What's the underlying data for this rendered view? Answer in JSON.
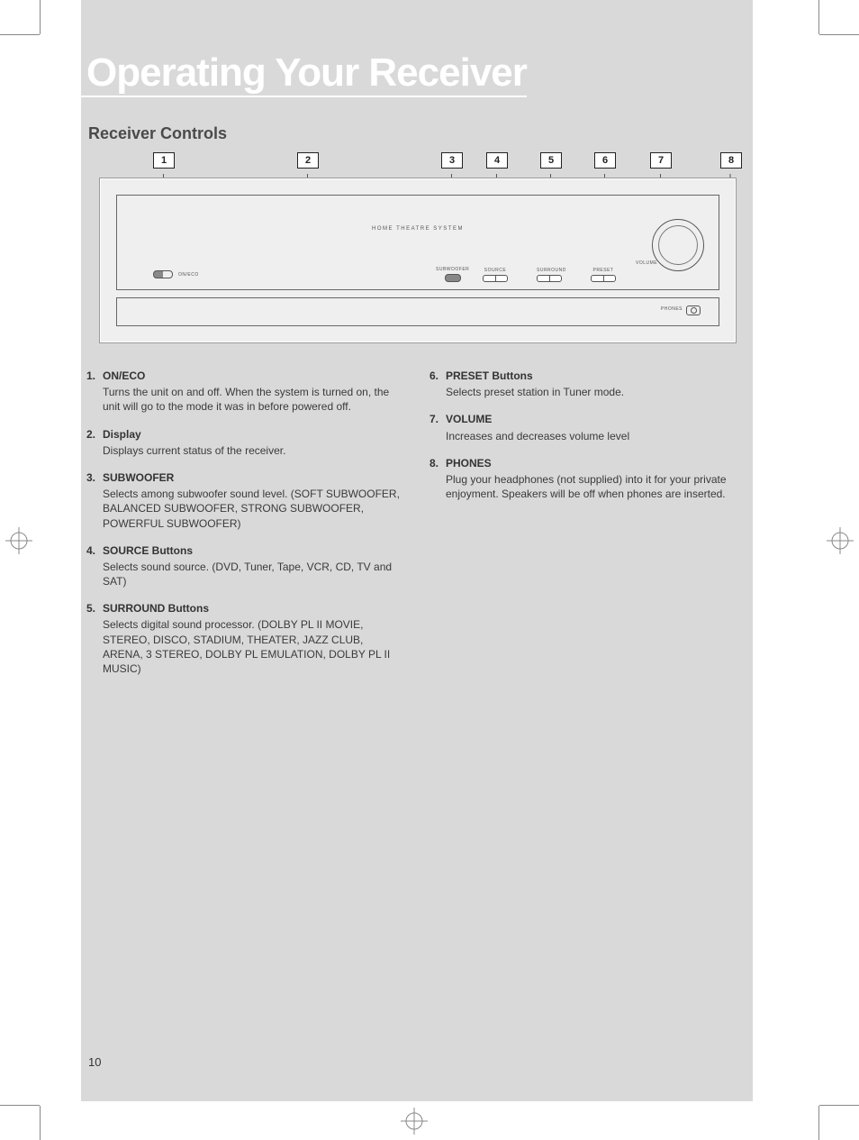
{
  "page_number": "10",
  "title": "Operating Your Receiver",
  "subtitle": "Receiver Controls",
  "diagram": {
    "display_label": "HOME THEATRE SYSTEM",
    "power_label": "ON/ECO",
    "controls": {
      "subwoofer": "SUBWOOFER",
      "source": "SOURCE",
      "surround": "SURROUND",
      "preset": "PRESET",
      "volume": "VOLUME"
    },
    "phones_label": "PHONES",
    "callouts": [
      "1",
      "2",
      "3",
      "4",
      "5",
      "6",
      "7",
      "8"
    ]
  },
  "left_items": [
    {
      "n": "1.",
      "t": "ON/ECO",
      "b": "Turns the unit on and off. When the system is turned on, the unit will go to the mode it was in before powered off."
    },
    {
      "n": "2.",
      "t": "Display",
      "b": "Displays current status of the receiver."
    },
    {
      "n": "3.",
      "t": "SUBWOOFER",
      "b": "Selects among subwoofer sound level. (SOFT SUBWOOFER, BALANCED SUBWOOFER, STRONG SUBWOOFER, POWERFUL SUBWOOFER)"
    },
    {
      "n": "4.",
      "t": "SOURCE Buttons",
      "b": "Selects sound source. (DVD, Tuner, Tape, VCR, CD, TV and SAT)"
    },
    {
      "n": "5.",
      "t": "SURROUND Buttons",
      "b": "Selects digital sound processor. (DOLBY PL II MOVIE, STEREO, DISCO, STADIUM, THEATER, JAZZ CLUB, ARENA, 3 STEREO, DOLBY PL EMULATION, DOLBY PL II MUSIC)"
    }
  ],
  "right_items": [
    {
      "n": "6.",
      "t": "PRESET Buttons",
      "b": "Selects preset station in Tuner mode."
    },
    {
      "n": "7.",
      "t": "VOLUME",
      "b": "Increases and decreases volume level"
    },
    {
      "n": "8.",
      "t": "PHONES",
      "b": "Plug your headphones (not supplied) into it  for your private enjoyment. Speakers will be off when phones are inserted."
    }
  ]
}
